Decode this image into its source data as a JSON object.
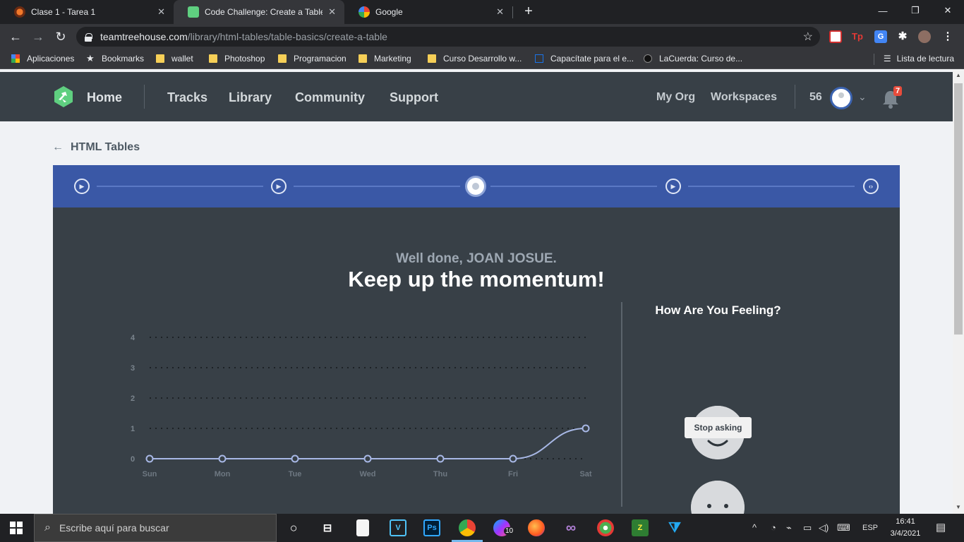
{
  "browser": {
    "tabs": [
      {
        "title": "Clase 1 - Tarea 1",
        "active": false
      },
      {
        "title": "Code Challenge: Create a Table",
        "active": true
      },
      {
        "title": "Google",
        "active": false
      }
    ],
    "url_host": "teamtreehouse.com",
    "url_path": "/library/html-tables/table-basics/create-a-table",
    "bookmarks": [
      {
        "label": "Aplicaciones",
        "icon": "apps-grid-icon"
      },
      {
        "label": "Bookmarks",
        "icon": "star-icon"
      },
      {
        "label": "wallet",
        "icon": "folder-icon"
      },
      {
        "label": "Photoshop",
        "icon": "folder-icon"
      },
      {
        "label": "Programacion",
        "icon": "folder-icon"
      },
      {
        "label": "Marketing",
        "icon": "folder-icon"
      },
      {
        "label": "Curso Desarrollo w...",
        "icon": "folder-icon"
      },
      {
        "label": "Capacítate para el e...",
        "icon": "bookmark-site-icon"
      },
      {
        "label": "LaCuerda: Curso de...",
        "icon": "lacuerda-icon"
      }
    ],
    "reading_list": "Lista de lectura"
  },
  "site": {
    "nav": {
      "home": "Home",
      "tracks": "Tracks",
      "library": "Library",
      "community": "Community",
      "support": "Support",
      "my_org": "My Org",
      "workspaces": "Workspaces",
      "points": "56",
      "notifications": "7"
    },
    "back_label": "HTML Tables",
    "stepper": [
      "play",
      "play",
      "current",
      "play",
      "code"
    ],
    "well_done": "Well done, JOAN JOSUE.",
    "headline": "Keep up the momentum!",
    "feeling_title": "How Are You Feeling?",
    "stop_asking": "Stop asking",
    "colors": {
      "header": "#384047",
      "stepper": "#3a58a6",
      "panel": "#384047",
      "logo": "#5fcf80"
    }
  },
  "chart_data": {
    "type": "line",
    "categories": [
      "Sun",
      "Mon",
      "Tue",
      "Wed",
      "Thu",
      "Fri",
      "Sat"
    ],
    "values": [
      0,
      0,
      0,
      0,
      0,
      0,
      1
    ],
    "yticks": [
      0,
      1,
      2,
      3,
      4
    ],
    "ylim": [
      0,
      4
    ],
    "grid": "dotted horizontal",
    "line_color": "#a8b8e6"
  },
  "taskbar": {
    "search_placeholder": "Escribe aquí para buscar",
    "messenger_badge": "10",
    "language": "ESP",
    "time": "16:41",
    "date": "3/4/2021"
  }
}
